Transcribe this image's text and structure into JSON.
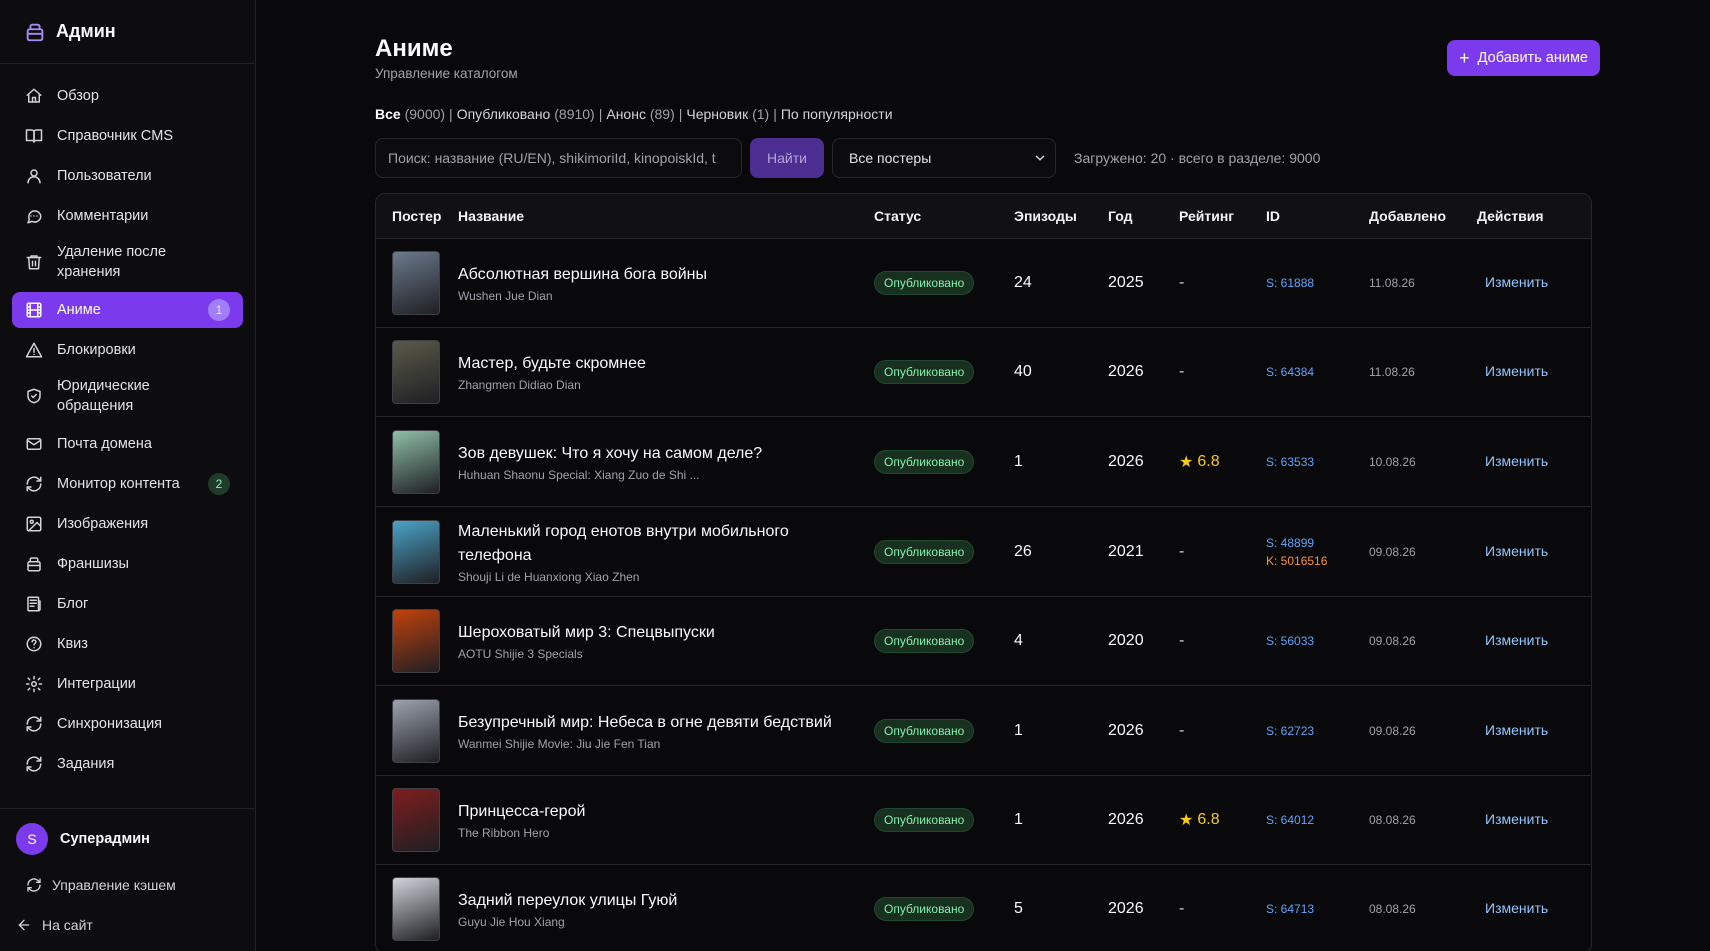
{
  "sidebar": {
    "brand": "Админ",
    "items": [
      {
        "label": "Обзор",
        "icon": "home-icon"
      },
      {
        "label": "Справочник CMS",
        "icon": "book-icon"
      },
      {
        "label": "Пользователи",
        "icon": "users-icon"
      },
      {
        "label": "Комментарии",
        "icon": "comment-icon"
      },
      {
        "label": "Удаление после хранения",
        "icon": "trash-icon"
      },
      {
        "label": "Аниме",
        "icon": "film-icon",
        "badge": "1"
      },
      {
        "label": "Блокировки",
        "icon": "alert-icon"
      },
      {
        "label": "Юридические обращения",
        "icon": "shield-icon"
      },
      {
        "label": "Почта домена",
        "icon": "mail-icon"
      },
      {
        "label": "Монитор контента",
        "icon": "refresh-icon",
        "badge": "2"
      },
      {
        "label": "Изображения",
        "icon": "image-icon"
      },
      {
        "label": "Франшизы",
        "icon": "box-icon"
      },
      {
        "label": "Блог",
        "icon": "newspaper-icon"
      },
      {
        "label": "Квиз",
        "icon": "question-icon"
      },
      {
        "label": "Интеграции",
        "icon": "gear-icon"
      },
      {
        "label": "Синхронизация",
        "icon": "sync-icon"
      },
      {
        "label": "Задания",
        "icon": "tasks-icon"
      }
    ],
    "user": {
      "initial": "S",
      "name": "Суперадмин"
    },
    "cache_link": "Управление кэшем",
    "site_link": "На сайт"
  },
  "header": {
    "title": "Аниме",
    "subtitle": "Управление каталогом",
    "add_button": "Добавить аниме"
  },
  "filters": [
    {
      "label": "Все",
      "count": "(9000)"
    },
    {
      "label": "Опубликовано",
      "count": "(8910)"
    },
    {
      "label": "Анонс",
      "count": "(89)"
    },
    {
      "label": "Черновик",
      "count": "(1)"
    },
    {
      "label": "По популярности",
      "count": ""
    }
  ],
  "search": {
    "placeholder": "Поиск: название (RU/EN), shikimoriId, kinopoiskId, t",
    "button": "Найти"
  },
  "poster_filter": {
    "selected": "Все постеры"
  },
  "loaded_text": "Загружено: 20 · всего в разделе: 9000",
  "table": {
    "headers": [
      "Постер",
      "Название",
      "Статус",
      "Эпизоды",
      "Год",
      "Рейтинг",
      "ID",
      "Добавлено",
      "Действия"
    ],
    "action_label": "Изменить",
    "rows": [
      {
        "title": "Абсолютная вершина бога войны",
        "subtitle": "Wushen Jue Dian",
        "status": "Опубликовано",
        "episodes": "24",
        "year": "2025",
        "rating": "-",
        "id_s": "S: 61888",
        "id_k": "",
        "added": "11.08.26",
        "poster_color": "#6b7a8c"
      },
      {
        "title": "Мастер, будьте скромнее",
        "subtitle": "Zhangmen Didiao Dian",
        "status": "Опубликовано",
        "episodes": "40",
        "year": "2026",
        "rating": "-",
        "id_s": "S: 64384",
        "id_k": "",
        "added": "11.08.26",
        "poster_color": "#5a5a4a"
      },
      {
        "title": "Зов девушек: Что я хочу на самом деле?",
        "subtitle": "Huhuan Shaonu Special: Xiang Zuo de Shi ...",
        "status": "Опубликовано",
        "episodes": "1",
        "year": "2026",
        "rating": "6.8",
        "id_s": "S: 63533",
        "id_k": "",
        "added": "10.08.26",
        "poster_color": "#8fbfa8"
      },
      {
        "title": "Маленький город енотов внутри мобильного телефона",
        "subtitle": "Shouji Li de Huanxiong Xiao Zhen",
        "status": "Опубликовано",
        "episodes": "26",
        "year": "2021",
        "rating": "-",
        "id_s": "S: 48899",
        "id_k": "K: 5016516",
        "added": "09.08.26",
        "poster_color": "#4aa3c8"
      },
      {
        "title": "Шероховатый мир 3: Спецвыпуски",
        "subtitle": "AOTU Shijie 3 Specials",
        "status": "Опубликовано",
        "episodes": "4",
        "year": "2020",
        "rating": "-",
        "id_s": "S: 56033",
        "id_k": "",
        "added": "09.08.26",
        "poster_color": "#c2410c"
      },
      {
        "title": "Безупречный мир: Небеса в огне девяти бедствий",
        "subtitle": "Wanmei Shijie Movie: Jiu Jie Fen Tian",
        "status": "Опубликовано",
        "episodes": "1",
        "year": "2026",
        "rating": "-",
        "id_s": "S: 62723",
        "id_k": "",
        "added": "09.08.26",
        "poster_color": "#9ca3af"
      },
      {
        "title": "Принцесса-герой",
        "subtitle": "The Ribbon Hero",
        "status": "Опубликовано",
        "episodes": "1",
        "year": "2026",
        "rating": "6.8",
        "id_s": "S: 64012",
        "id_k": "",
        "added": "08.08.26",
        "poster_color": "#7f1d1d"
      },
      {
        "title": "Задний переулок улицы Гуюй",
        "subtitle": "Guyu Jie Hou Xiang",
        "status": "Опубликовано",
        "episodes": "5",
        "year": "2026",
        "rating": "-",
        "id_s": "S: 64713",
        "id_k": "",
        "added": "08.08.26",
        "poster_color": "#d1d5db"
      }
    ]
  }
}
